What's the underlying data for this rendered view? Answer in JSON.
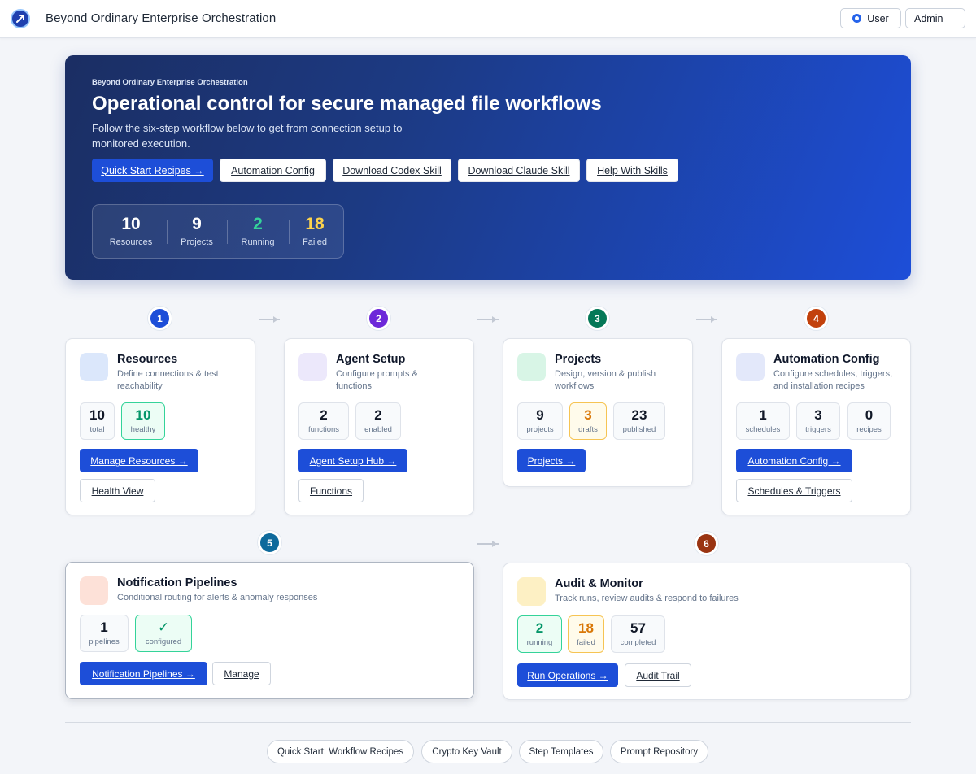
{
  "app": {
    "title": "Beyond Ordinary Enterprise Orchestration"
  },
  "header": {
    "user_label": "User",
    "admin_label": "Admin"
  },
  "hero": {
    "kicker": "Beyond Ordinary Enterprise Orchestration",
    "title": "Operational control for secure managed file workflows",
    "subtitle": "Follow the six-step workflow below to get from connection setup to monitored execution.",
    "buttons": [
      "Quick Start Recipes →",
      "Automation Config",
      "Download Codex Skill",
      "Download Claude Skill",
      "Help With Skills"
    ],
    "stats": [
      {
        "value": "10",
        "label": "Resources",
        "color": "#ffffff"
      },
      {
        "value": "9",
        "label": "Projects",
        "color": "#ffffff"
      },
      {
        "value": "2",
        "label": "Running",
        "color": "#34d399"
      },
      {
        "value": "18",
        "label": "Failed",
        "color": "#fcd34d"
      }
    ]
  },
  "steps": [
    {
      "number": "1",
      "color": "#1d4ed8",
      "icon_bg": "#dbe7fb",
      "title": "Resources",
      "description": "Define connections & test reachability",
      "metrics": [
        {
          "value": "10",
          "label": "total",
          "style": ""
        },
        {
          "value": "10",
          "label": "healthy",
          "style": "green"
        }
      ],
      "primary_action": "Manage Resources →",
      "secondary_action": "Health View"
    },
    {
      "number": "2",
      "color": "#6d28d9",
      "icon_bg": "#ece8fb",
      "title": "Agent Setup",
      "description": "Configure prompts & functions",
      "metrics": [
        {
          "value": "2",
          "label": "functions",
          "style": ""
        },
        {
          "value": "2",
          "label": "enabled",
          "style": ""
        }
      ],
      "primary_action": "Agent Setup Hub →",
      "secondary_action": "Functions"
    },
    {
      "number": "3",
      "color": "#047857",
      "icon_bg": "#d8f5e6",
      "title": "Projects",
      "description": "Design, version & publish workflows",
      "metrics": [
        {
          "value": "9",
          "label": "projects",
          "style": ""
        },
        {
          "value": "3",
          "label": "drafts",
          "style": "amber"
        },
        {
          "value": "23",
          "label": "published",
          "style": ""
        }
      ],
      "primary_action": "Projects →",
      "secondary_action": ""
    },
    {
      "number": "4",
      "color": "#c2410c",
      "icon_bg": "#e3e8fa",
      "title": "Automation Config",
      "description": "Configure schedules, triggers, and installation recipes",
      "metrics": [
        {
          "value": "1",
          "label": "schedules",
          "style": ""
        },
        {
          "value": "3",
          "label": "triggers",
          "style": ""
        },
        {
          "value": "0",
          "label": "recipes",
          "style": ""
        }
      ],
      "primary_action": "Automation Config →",
      "secondary_action": "Schedules & Triggers"
    },
    {
      "number": "5",
      "color": "#0e6a9c",
      "icon_bg": "#fde1d8",
      "title": "Notification Pipelines",
      "description": "Conditional routing for alerts & anomaly responses",
      "metrics": [
        {
          "value": "1",
          "label": "pipelines",
          "style": ""
        },
        {
          "value": "✓",
          "label": "configured",
          "style": "green"
        }
      ],
      "primary_action": "Notification Pipelines →",
      "secondary_action": "Manage"
    },
    {
      "number": "6",
      "color": "#9a3412",
      "icon_bg": "#fdf0c4",
      "title": "Audit & Monitor",
      "description": "Track runs, review audits & respond to failures",
      "metrics": [
        {
          "value": "2",
          "label": "running",
          "style": "green"
        },
        {
          "value": "18",
          "label": "failed",
          "style": "amber"
        },
        {
          "value": "57",
          "label": "completed",
          "style": ""
        }
      ],
      "primary_action": "Run Operations →",
      "secondary_action": "Audit Trail"
    }
  ],
  "footer_links": [
    "Quick Start: Workflow Recipes",
    "Crypto Key Vault",
    "Step Templates",
    "Prompt Repository"
  ]
}
